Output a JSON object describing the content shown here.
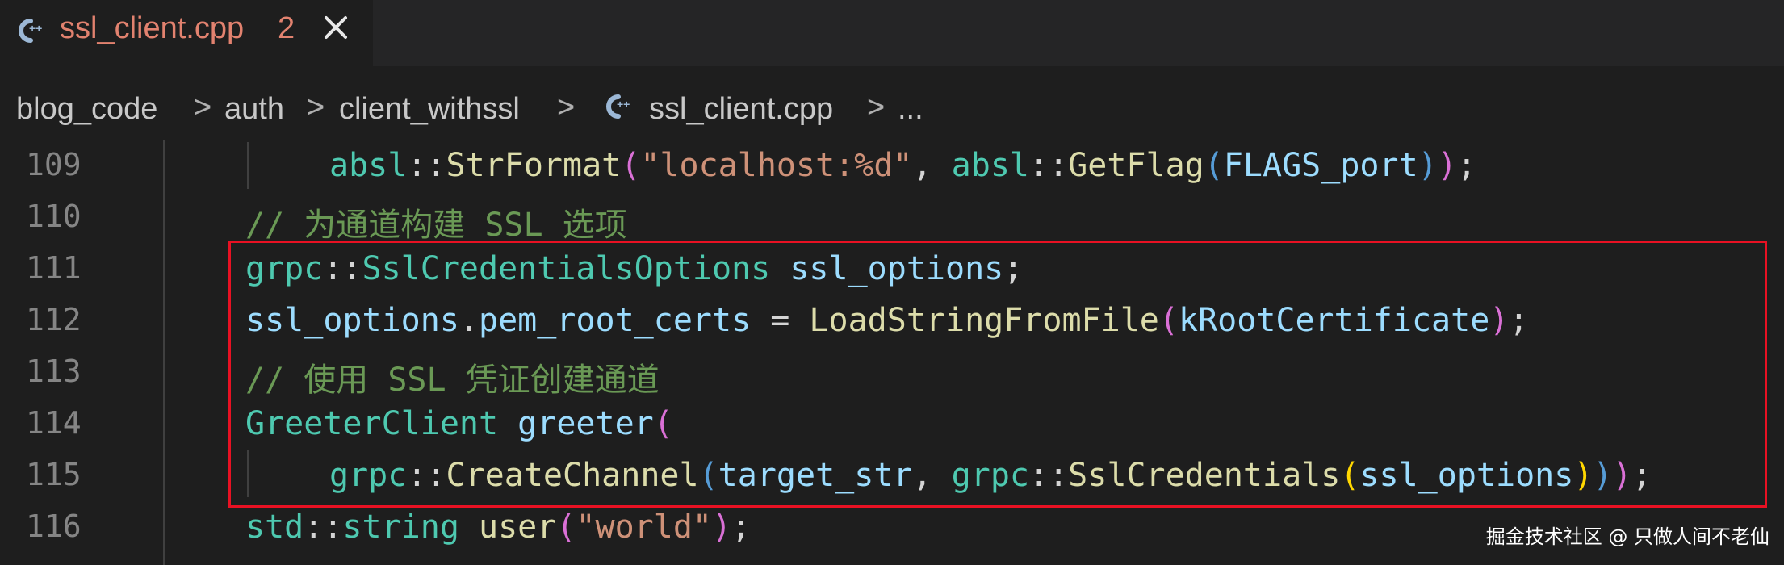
{
  "tab": {
    "title": "ssl_client.cpp",
    "problem_count": "2",
    "icon": "cpp-file-icon",
    "close_icon": "close-icon"
  },
  "breadcrumb": {
    "items": [
      "blog_code",
      "auth",
      "client_withssl",
      "ssl_client.cpp",
      "..."
    ],
    "separator": ">"
  },
  "editor": {
    "lines": [
      {
        "number": "109"
      },
      {
        "number": "110"
      },
      {
        "number": "111"
      },
      {
        "number": "112"
      },
      {
        "number": "113"
      },
      {
        "number": "114"
      },
      {
        "number": "115"
      },
      {
        "number": "116"
      }
    ],
    "tokens": {
      "l109": [
        "absl",
        "::",
        "StrFormat",
        "(",
        "\"localhost:%d\"",
        ", ",
        "absl",
        "::",
        "GetFlag",
        "(",
        "FLAGS_port",
        ")",
        ")",
        ";"
      ],
      "l110": [
        "// 为通道构建 SSL 选项"
      ],
      "l111": [
        "grpc",
        "::",
        "SslCredentialsOptions",
        " ",
        "ssl_options",
        ";"
      ],
      "l112": [
        "ssl_options",
        ".",
        "pem_root_certs",
        " = ",
        "LoadStringFromFile",
        "(",
        "kRootCertificate",
        ")",
        ";"
      ],
      "l113": [
        "// 使用 SSL 凭证创建通道"
      ],
      "l114": [
        "GreeterClient",
        " ",
        "greeter",
        "("
      ],
      "l115": [
        "grpc",
        "::",
        "CreateChannel",
        "(",
        "target_str",
        ", ",
        "grpc",
        "::",
        "SslCredentials",
        "(",
        "ssl_options",
        ")",
        ")",
        ")",
        ";"
      ],
      "l116": [
        "std",
        "::",
        "string",
        " ",
        "user",
        "(",
        "\"world\"",
        ")",
        ";"
      ]
    }
  },
  "watermark": "掘金技术社区 @ 只做人间不老仙",
  "colors": {
    "namespace": "#4ec9b0",
    "function": "#dcdcaa",
    "string": "#ce9178",
    "variable": "#9cdcfe",
    "comment": "#6a9955",
    "bracket1": "#da70d6",
    "bracket2": "#569cd6",
    "bracket3": "#ffd700",
    "tab_title": "#e2826f",
    "highlight_box": "#e81123"
  }
}
